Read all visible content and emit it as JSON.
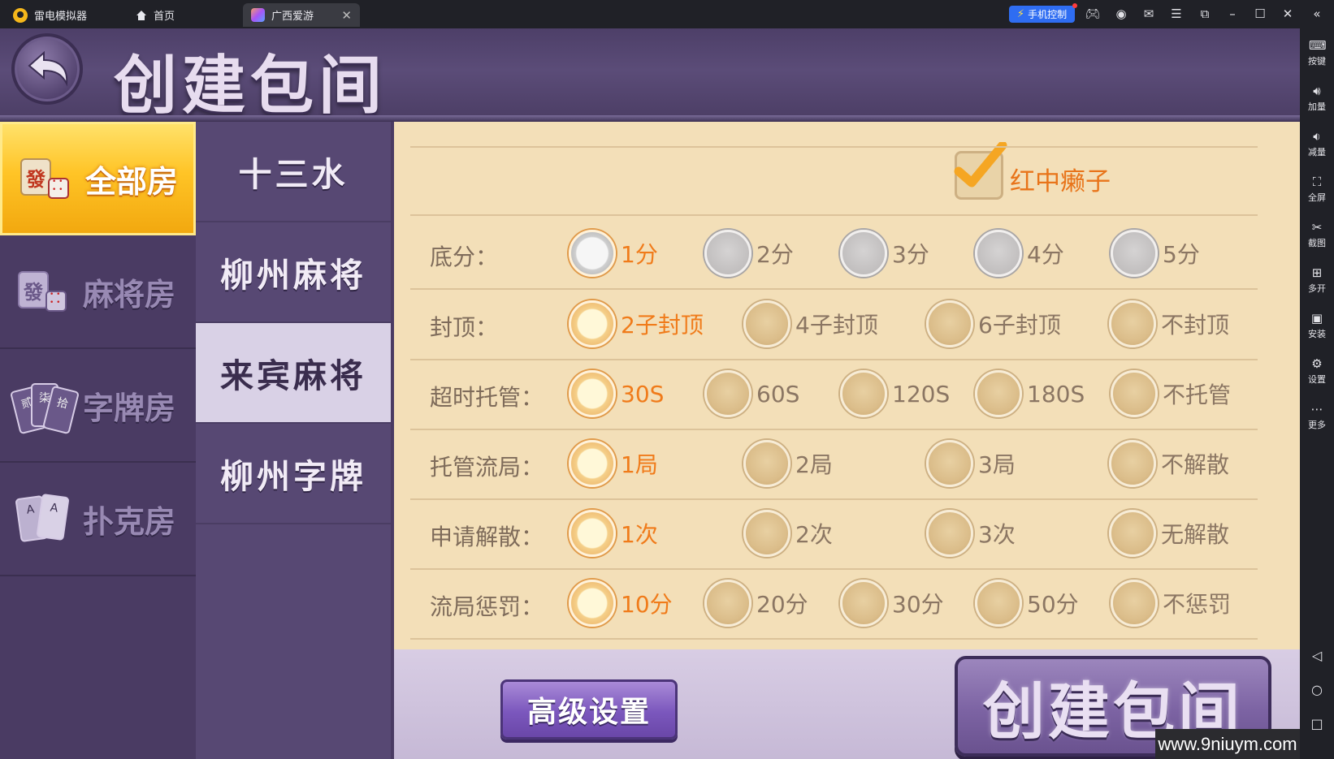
{
  "emulator": {
    "app_name": "雷电模拟器",
    "tabs": [
      {
        "label": "首页"
      },
      {
        "label": "广西爱游"
      }
    ],
    "phone_control": "手机控制",
    "sidebar": [
      "按键",
      "加量",
      "减量",
      "全屏",
      "截图",
      "多开",
      "安装",
      "设置",
      "更多"
    ]
  },
  "header": {
    "title": "创建包间"
  },
  "categories": [
    {
      "label": "全部房",
      "active": true
    },
    {
      "label": "麻将房",
      "active": false
    },
    {
      "label": "字牌房",
      "active": false
    },
    {
      "label": "扑克房",
      "active": false
    }
  ],
  "category_icons": {
    "mahjong_tile": "發",
    "cards": [
      "贰",
      "柒",
      "拾"
    ],
    "poker": [
      "A",
      "A"
    ]
  },
  "game_types": [
    {
      "label": "十三水",
      "active": false
    },
    {
      "label": "柳州麻将",
      "active": false
    },
    {
      "label": "来宾麻将",
      "active": true
    },
    {
      "label": "柳州字牌",
      "active": false
    }
  ],
  "options": {
    "wild_checkbox": {
      "label": "红中癞子",
      "checked": true
    },
    "rows": [
      {
        "label": "底分：",
        "options": [
          "1分",
          "2分",
          "3分",
          "4分",
          "5分"
        ],
        "selected": 0
      },
      {
        "label": "封顶：",
        "options": [
          "2子封顶",
          "4子封顶",
          "6子封顶",
          "不封顶"
        ],
        "selected": 0
      },
      {
        "label": "超时托管：",
        "options": [
          "30S",
          "60S",
          "120S",
          "180S",
          "不托管"
        ],
        "selected": 0
      },
      {
        "label": "托管流局：",
        "options": [
          "1局",
          "2局",
          "3局",
          "不解散"
        ],
        "selected": 0
      },
      {
        "label": "申请解散：",
        "options": [
          "1次",
          "2次",
          "3次",
          "无解散"
        ],
        "selected": 0
      },
      {
        "label": "流局惩罚：",
        "options": [
          "10分",
          "20分",
          "30分",
          "50分",
          "不惩罚"
        ],
        "selected": 0
      }
    ]
  },
  "buttons": {
    "advanced": "高级设置",
    "create": "创建包间"
  },
  "watermark": "www.9niuym.com",
  "colors": {
    "selected_text": "#f07b1a",
    "panel_bg": "#f3dfb8",
    "active_category": "#ffc426",
    "brand_purple": "#4a3b63"
  }
}
